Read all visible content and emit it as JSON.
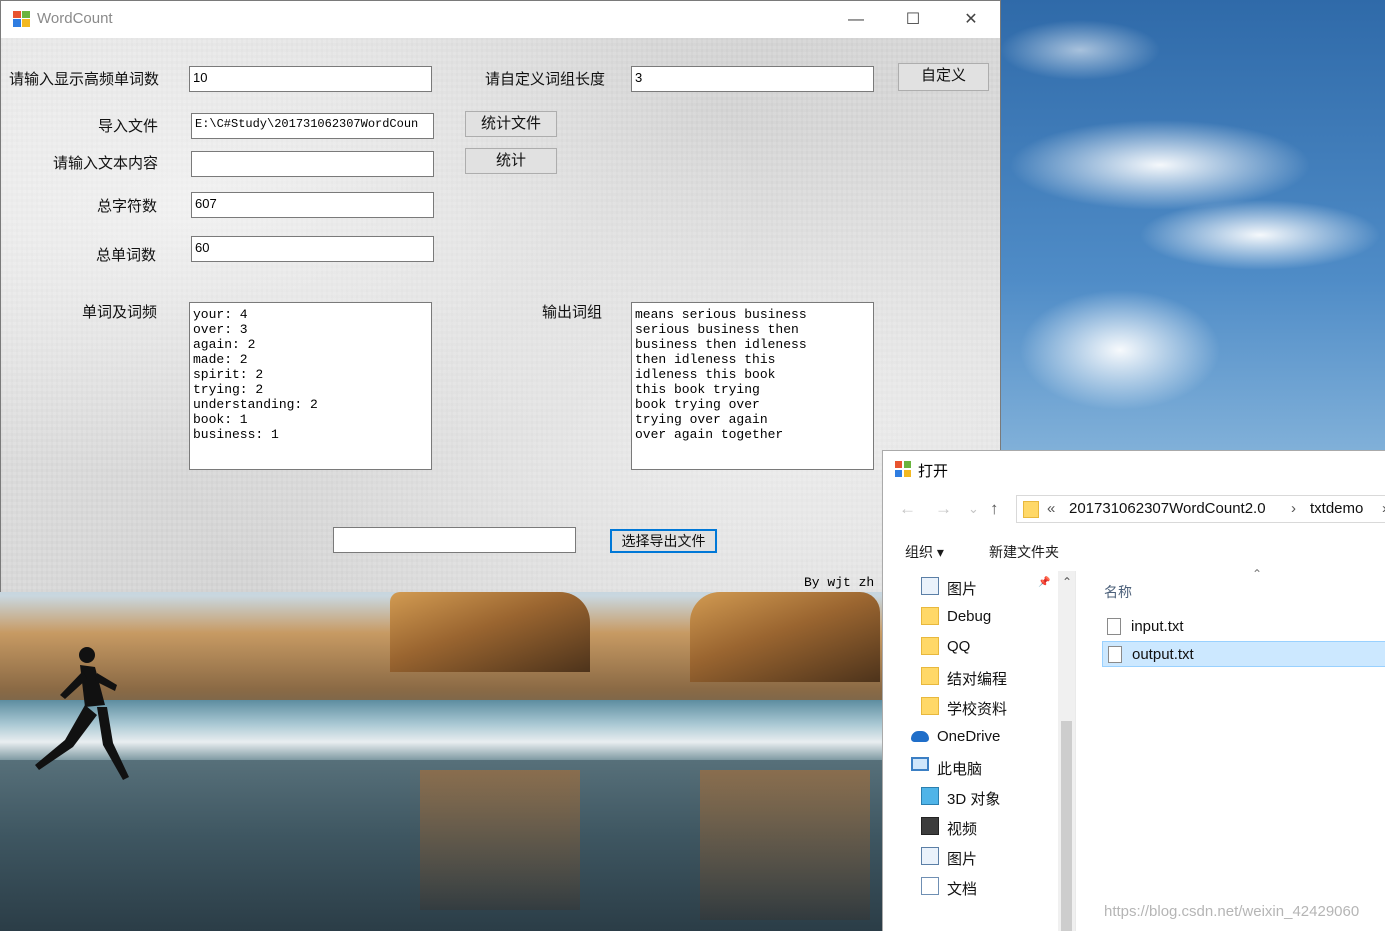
{
  "wordcount": {
    "title": "WordCount",
    "controls": {
      "minimize": "—",
      "maximize": "☐",
      "close": "✕"
    },
    "labels": {
      "top_n": "请输入显示高频单词数",
      "phrase_len": "请自定义词组长度",
      "import_file": "导入文件",
      "input_text": "请输入文本内容",
      "total_chars": "总字符数",
      "total_words": "总单词数",
      "word_freq": "单词及词频",
      "output_phrases": "输出词组"
    },
    "values": {
      "top_n": "10",
      "phrase_len": "3",
      "import_file": "E:\\C#Study\\201731062307WordCoun",
      "input_text": "",
      "total_chars": "607",
      "total_words": "60",
      "export_path": ""
    },
    "buttons": {
      "custom": "自定义",
      "count_file": "统计文件",
      "count": "统计",
      "choose_export": "选择导出文件"
    },
    "word_freq_lines": [
      "your: 4",
      "over: 3",
      "again: 2",
      "made: 2",
      "spirit: 2",
      "trying: 2",
      "understanding: 2",
      "book: 1",
      "business: 1"
    ],
    "phrase_lines": [
      "means serious business",
      "serious business then",
      "business then idleness",
      "then idleness this",
      "idleness this book",
      "this book trying",
      "book trying over",
      "trying over again",
      "over again together"
    ],
    "byline": "By wjt zh"
  },
  "open_dialog": {
    "title": "打开",
    "nav_back": "←",
    "nav_forward": "→",
    "nav_dropdown": "⌄",
    "nav_up": "↑",
    "address": {
      "chevron": "«",
      "parts": [
        "201731062307WordCount2.0",
        "txtdemo"
      ],
      "separators": [
        "›",
        "›"
      ]
    },
    "commands": {
      "organize": "组织 ▾",
      "new_folder": "新建文件夹"
    },
    "nav_items": [
      {
        "label": "图片",
        "icon": "pictures-icon"
      },
      {
        "label": "Debug",
        "icon": "folder-icon"
      },
      {
        "label": "QQ",
        "icon": "folder-icon"
      },
      {
        "label": "结对编程",
        "icon": "folder-icon"
      },
      {
        "label": "学校资料",
        "icon": "folder-icon"
      },
      {
        "label": "OneDrive",
        "icon": "onedrive-icon"
      },
      {
        "label": "此电脑",
        "icon": "computer-icon"
      },
      {
        "label": "3D 对象",
        "icon": "3d-objects-icon"
      },
      {
        "label": "视频",
        "icon": "videos-icon"
      },
      {
        "label": "图片",
        "icon": "pictures-icon"
      },
      {
        "label": "文档",
        "icon": "documents-icon"
      }
    ],
    "column_header": "名称",
    "files": [
      {
        "name": "input.txt",
        "selected": false
      },
      {
        "name": "output.txt",
        "selected": true
      }
    ]
  },
  "watermark": "https://blog.csdn.net/weixin_42429060",
  "colors": {
    "focus_border": "#0078d7",
    "selection": "#cce8ff",
    "folder": "#ffd867"
  }
}
